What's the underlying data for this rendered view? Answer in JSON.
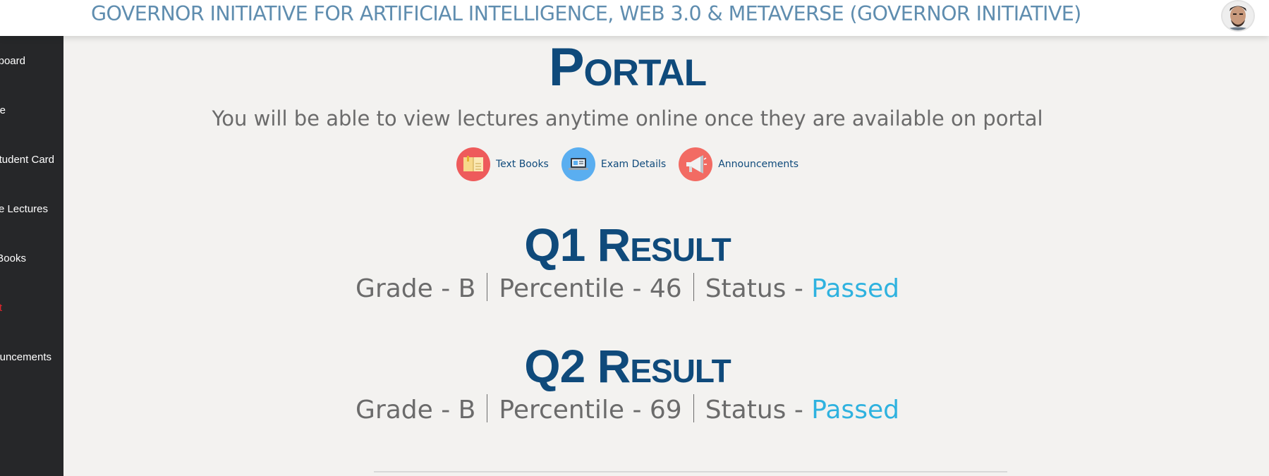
{
  "header": {
    "title": "GOVERNOR INITIATIVE FOR ARTIFICIAL INTELLIGENCE, WEB 3.0 & METAVERSE (GOVERNOR INITIATIVE)"
  },
  "sidebar": {
    "items": [
      {
        "label": "board"
      },
      {
        "label": "e"
      },
      {
        "label": "tudent Card"
      },
      {
        "label": "e Lectures"
      },
      {
        "label": "Books"
      },
      {
        "label": "t"
      },
      {
        "label": "uncements"
      }
    ]
  },
  "portal": {
    "title": "Portal",
    "subtitle": "You will be able to view lectures anytime online once they are available on portal"
  },
  "quicklinks": [
    {
      "label": "Text Books",
      "icon": "book-icon",
      "color": "#ee5b5b"
    },
    {
      "label": "Exam Details",
      "icon": "laptop-icon",
      "color": "#5aaef0"
    },
    {
      "label": "Announcements",
      "icon": "megaphone-icon",
      "color": "#f26b63"
    }
  ],
  "results": [
    {
      "title": "Q1 Result",
      "grade": "Grade - B",
      "percentile": "Percentile - 46",
      "status_prefix": "Status - ",
      "status": "Passed"
    },
    {
      "title": "Q2 Result",
      "grade": "Grade - B",
      "percentile": "Percentile - 69",
      "status_prefix": "Status - ",
      "status": "Passed"
    }
  ],
  "colors": {
    "title": "#0f4a7b",
    "header_title": "#5f8daf",
    "status_passed": "#2fb2df",
    "sidebar_bg": "#262729",
    "page_bg": "#f3f2f0"
  }
}
